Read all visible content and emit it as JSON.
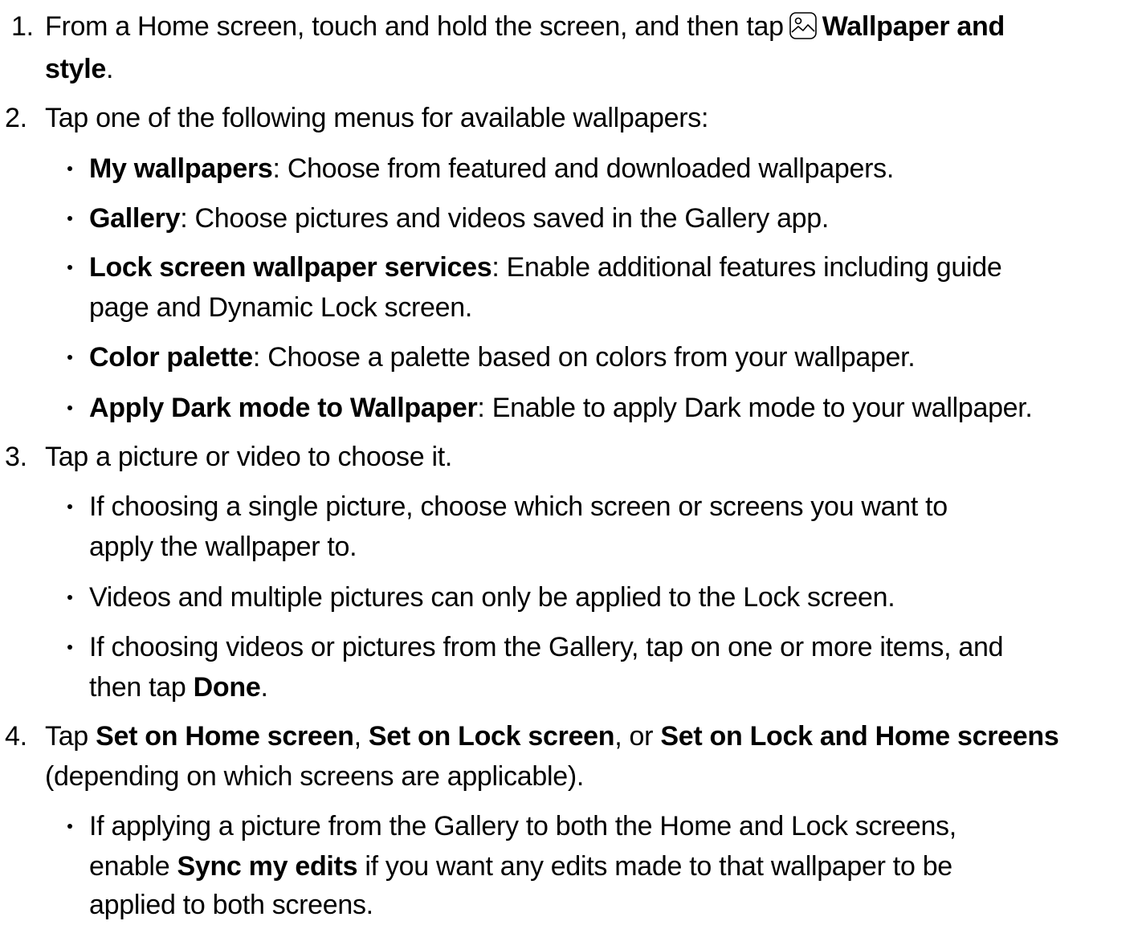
{
  "steps": [
    {
      "number": "1.",
      "pre": "From a Home screen, touch and hold the screen, and then tap",
      "icon": "wallpaper-icon",
      "bold_line1": "Wallpaper and",
      "bold_line2": "style",
      "tail": "."
    },
    {
      "number": "2.",
      "text": "Tap one of the following menus for available wallpapers:",
      "bullets": [
        {
          "bold": "My wallpapers",
          "text": ": Choose from featured and downloaded wallpapers."
        },
        {
          "bold": "Gallery",
          "text": ": Choose pictures and videos saved in the Gallery app."
        },
        {
          "bold": "Lock screen wallpaper services",
          "text": ": Enable additional features including guide",
          "cont": "page and Dynamic Lock screen."
        },
        {
          "bold": "Color palette",
          "text": ": Choose a palette based on colors from your wallpaper."
        },
        {
          "bold": "Apply Dark mode to Wallpaper",
          "text": ": Enable to apply Dark mode to your wallpaper."
        }
      ]
    },
    {
      "number": "3.",
      "text": "Tap a picture or video to choose it.",
      "bullets": [
        {
          "text": "If choosing a single picture, choose which screen or screens you want to",
          "cont": "apply the wallpaper to."
        },
        {
          "text": "Videos and multiple pictures can only be applied to the Lock screen."
        },
        {
          "text": "If choosing videos or pictures from the Gallery, tap on one or more items, and",
          "cont_pre": "then tap ",
          "cont_bold": "Done",
          "cont_tail": "."
        }
      ]
    },
    {
      "number": "4.",
      "pre": "Tap ",
      "bold1": "Set on Home screen",
      "sep1": ", ",
      "bold2": "Set on Lock screen",
      "sep2": ", or ",
      "bold3": "Set on Lock and Home screens",
      "cont": "(depending on which screens are applicable).",
      "bullets": [
        {
          "text": "If applying a picture from the Gallery to both the Home and Lock screens,",
          "cont_pre": "enable ",
          "cont_bold": "Sync my edits",
          "cont_tail": " if you want any edits made to that wallpaper to be",
          "cont2": "applied to both screens."
        }
      ]
    }
  ]
}
